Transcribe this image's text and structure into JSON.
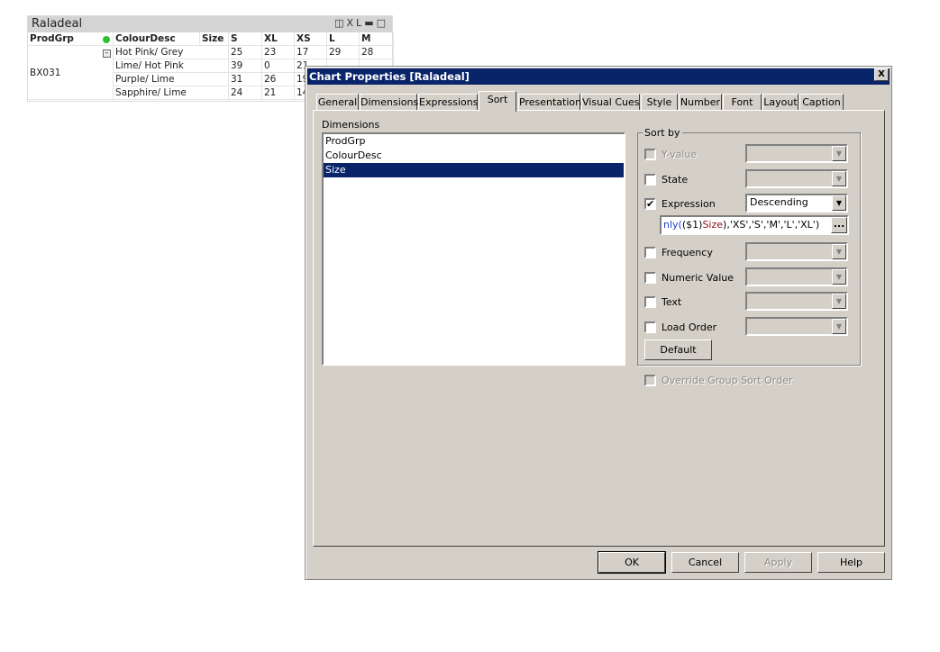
{
  "table": {
    "title": "Raladeal",
    "icons": [
      "print-icon",
      "xl-icon",
      "minimize-icon",
      "maximize-icon"
    ],
    "xl_label": "XL",
    "headers": [
      "ProdGrp",
      "ColourDesc",
      "Size",
      "S",
      "XL",
      "XS",
      "L",
      "M"
    ],
    "prodgrp": "BX031",
    "rows": [
      {
        "colour": "Hot Pink/ Grey",
        "S": "25",
        "XL": "23",
        "XS": "17",
        "L": "29",
        "M": "28"
      },
      {
        "colour": "Lime/ Hot Pink",
        "S": "39",
        "XL": "0",
        "XS": "21",
        "L": "",
        "M": ""
      },
      {
        "colour": "Purple/ Lime",
        "S": "31",
        "XL": "26",
        "XS": "19",
        "L": "",
        "M": ""
      },
      {
        "colour": "Sapphire/ Lime",
        "S": "24",
        "XL": "21",
        "XS": "14",
        "L": "",
        "M": ""
      }
    ]
  },
  "dialog": {
    "title": "Chart Properties [Raladeal]",
    "close": "X",
    "tabs": [
      "General",
      "Dimensions",
      "Expressions",
      "Sort",
      "Presentation",
      "Visual Cues",
      "Style",
      "Number",
      "Font",
      "Layout",
      "Caption"
    ],
    "active_tab": "Sort",
    "dimensions_label": "Dimensions",
    "dimensions": [
      "ProdGrp",
      "ColourDesc",
      "Size"
    ],
    "selected_dimension": "Size",
    "sort_by_label": "Sort by",
    "options": [
      {
        "label": "Y-value",
        "checked": false,
        "enabled": false,
        "value": ""
      },
      {
        "label": "State",
        "checked": false,
        "enabled": true,
        "value": ""
      },
      {
        "label": "Expression",
        "checked": true,
        "enabled": true,
        "value": "Descending"
      },
      {
        "label": "Frequency",
        "checked": false,
        "enabled": true,
        "value": ""
      },
      {
        "label": "Numeric Value",
        "checked": false,
        "enabled": true,
        "value": ""
      },
      {
        "label": "Text",
        "checked": false,
        "enabled": true,
        "value": ""
      },
      {
        "label": "Load Order",
        "checked": false,
        "enabled": true,
        "value": ""
      }
    ],
    "expression_parts": [
      "nly(",
      "($1)",
      "Size",
      ")",
      ",'XS','S','M','L','XL')"
    ],
    "ellipsis": "...",
    "default_button": "Default",
    "override_label": "Override Group Sort Order",
    "buttons": {
      "ok": "OK",
      "cancel": "Cancel",
      "apply": "Apply",
      "help": "Help"
    }
  }
}
